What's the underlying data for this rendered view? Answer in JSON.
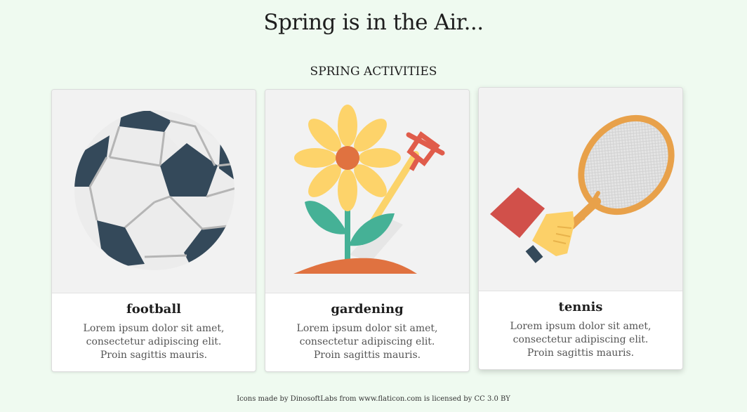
{
  "page": {
    "title": "Spring is in the Air...",
    "section_title": "SPRING ACTIVITIES"
  },
  "cards": [
    {
      "title": "football",
      "text": "Lorem ipsum dolor sit amet, consectetur adipiscing elit. Proin sagittis mauris.",
      "icon": "soccer-ball-icon"
    },
    {
      "title": "gardening",
      "text": "Lorem ipsum dolor sit amet, consectetur adipiscing elit. Proin sagittis mauris.",
      "icon": "sunflower-shovel-icon"
    },
    {
      "title": "tennis",
      "text": "Lorem ipsum dolor sit amet, consectetur adipiscing elit. Proin sagittis mauris.",
      "icon": "tennis-racket-icon"
    }
  ],
  "footer": {
    "credit": "Icons made by DinosoftLabs from www.flaticon.com is licensed by CC 3.0 BY"
  },
  "colors": {
    "background": "#effaf0",
    "card": "#ffffff",
    "image_bg": "#f2f2f2"
  }
}
